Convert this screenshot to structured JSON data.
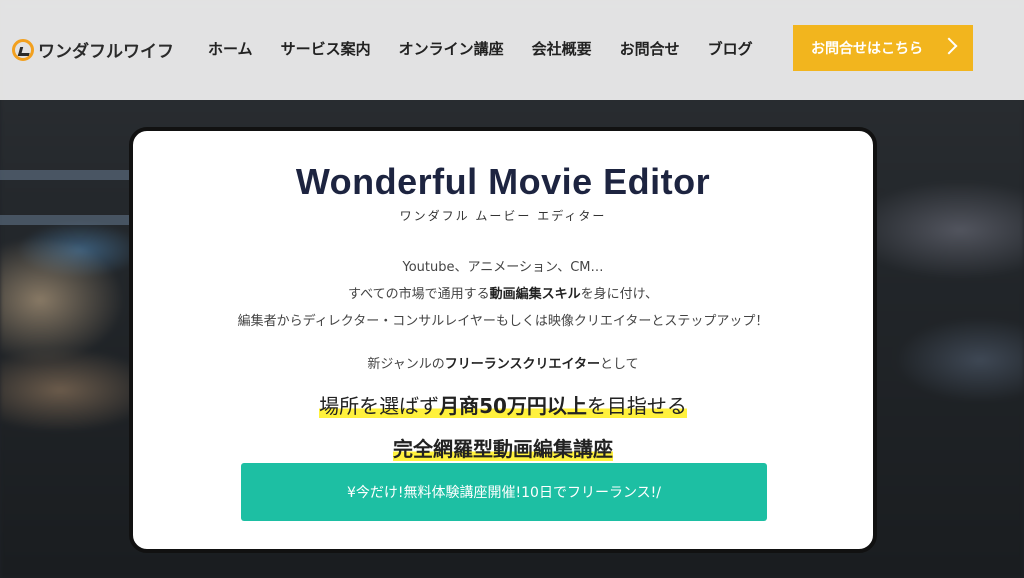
{
  "header": {
    "logo_text": "ワンダフルワイフ",
    "nav": [
      "ホーム",
      "サービス案内",
      "オンライン講座",
      "会社概要",
      "お問合せ",
      "ブログ"
    ],
    "cta_label": "お問合せはこちら"
  },
  "hero": {
    "title": "Wonderful Movie Editor",
    "subtitle": "ワンダフル ムービー エディター",
    "desc_line1": "Youtube、アニメーション、CM…",
    "desc_line2_pre": "すべての市場で通用する",
    "desc_line2_bold": "動画編集スキル",
    "desc_line2_post": "を身に付け、",
    "desc_line3": "編集者からディレクター・コンサルレイヤーもしくは映像クリエイターとステップアップ！",
    "lead_pre": "新ジャンルの",
    "lead_bold": "フリーランスクリエイター",
    "lead_post": "として",
    "headline1_pre": "場所を選ばず",
    "headline1_bold": "月商50万円以上",
    "headline1_post": "を目指せる",
    "headline2": "完全網羅型動画編集講座",
    "cta_label": "¥今だけ!無料体験講座開催!10日でフリーランス!/"
  },
  "colors": {
    "accent_yellow": "#f2b51e",
    "accent_teal": "#1dbfa3",
    "highlight": "#fff13d",
    "title_navy": "#1d2440"
  }
}
